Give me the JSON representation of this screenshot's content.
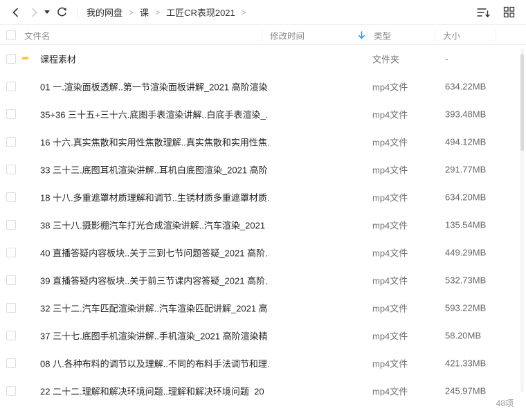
{
  "colors": {
    "accent": "#2196f3",
    "folder": "#ffc542",
    "video": "#8987e8",
    "icon": "#333333",
    "icon-disabled": "#cccccc"
  },
  "toolbar": {
    "back_icon": "chevron-left",
    "forward_icon": "chevron-right",
    "history_caret": "caret-down",
    "refresh_icon": "refresh",
    "breadcrumb": {
      "items": [
        "我的网盘",
        "课",
        "工匠CR表现2021"
      ],
      "separator": ">"
    },
    "sort_icon": "sort-descending",
    "view_icon": "grid-view"
  },
  "table": {
    "columns": {
      "name": "文件名",
      "modified": "修改时间",
      "type": "类型",
      "size": "大小"
    },
    "sort_column": "modified",
    "sort_direction": "descending",
    "rows": [
      {
        "icon": "folder",
        "name": "课程素材",
        "modified": "",
        "type": "文件夹",
        "size": "-"
      },
      {
        "icon": "video",
        "name": "01 一.渲染面板透解..第一节渲染面板讲解_2021 高阶渲染...",
        "modified": "",
        "type": "mp4文件",
        "size": "634.22MB"
      },
      {
        "icon": "video",
        "name": "35+36 三十五+三十六.底图手表渲染讲解..白底手表渲染_...",
        "modified": "",
        "type": "mp4文件",
        "size": "393.48MB"
      },
      {
        "icon": "video",
        "name": "16 十六.真实焦散和实用性焦散理解..真实焦散和实用性焦...",
        "modified": "",
        "type": "mp4文件",
        "size": "494.12MB"
      },
      {
        "icon": "video",
        "name": "33 三十三.底图耳机渲染讲解..耳机白底图渲染_2021 高阶...",
        "modified": "",
        "type": "mp4文件",
        "size": "291.77MB"
      },
      {
        "icon": "video",
        "name": "18 十八.多重遮罩材质理解和调节..生锈材质多重遮罩材质...",
        "modified": "",
        "type": "mp4文件",
        "size": "634.20MB"
      },
      {
        "icon": "video",
        "name": "38 三十八.摄影棚汽车打光合成渲染讲解..汽车渲染_2021 ...",
        "modified": "",
        "type": "mp4文件",
        "size": "135.54MB"
      },
      {
        "icon": "video",
        "name": "40 直播答疑内容板块..关于三到七节问题答疑_2021 高阶...",
        "modified": "",
        "type": "mp4文件",
        "size": "449.29MB"
      },
      {
        "icon": "video",
        "name": "39 直播答疑内容板块..关于前三节课内容答疑_2021 高阶...",
        "modified": "",
        "type": "mp4文件",
        "size": "532.73MB"
      },
      {
        "icon": "video",
        "name": "32 三十二.汽车匹配渲染讲解..汽车渲染匹配讲解_2021 高...",
        "modified": "",
        "type": "mp4文件",
        "size": "593.22MB"
      },
      {
        "icon": "video",
        "name": "37 三十七.底图手机渲染讲解..手机渲染_2021 高阶渲染精...",
        "modified": "",
        "type": "mp4文件",
        "size": "58.20MB"
      },
      {
        "icon": "video",
        "name": "08 八.各种布料的调节以及理解..不同的布料手法调节和理...",
        "modified": "",
        "type": "mp4文件",
        "size": "421.33MB"
      },
      {
        "icon": "video",
        "name": "22 二十二.理解和解决环境问题..理解和解决环境问题_20",
        "modified": "",
        "type": "mp4文件",
        "size": "245.97MB"
      }
    ]
  },
  "footer": {
    "item_count": "48项"
  }
}
